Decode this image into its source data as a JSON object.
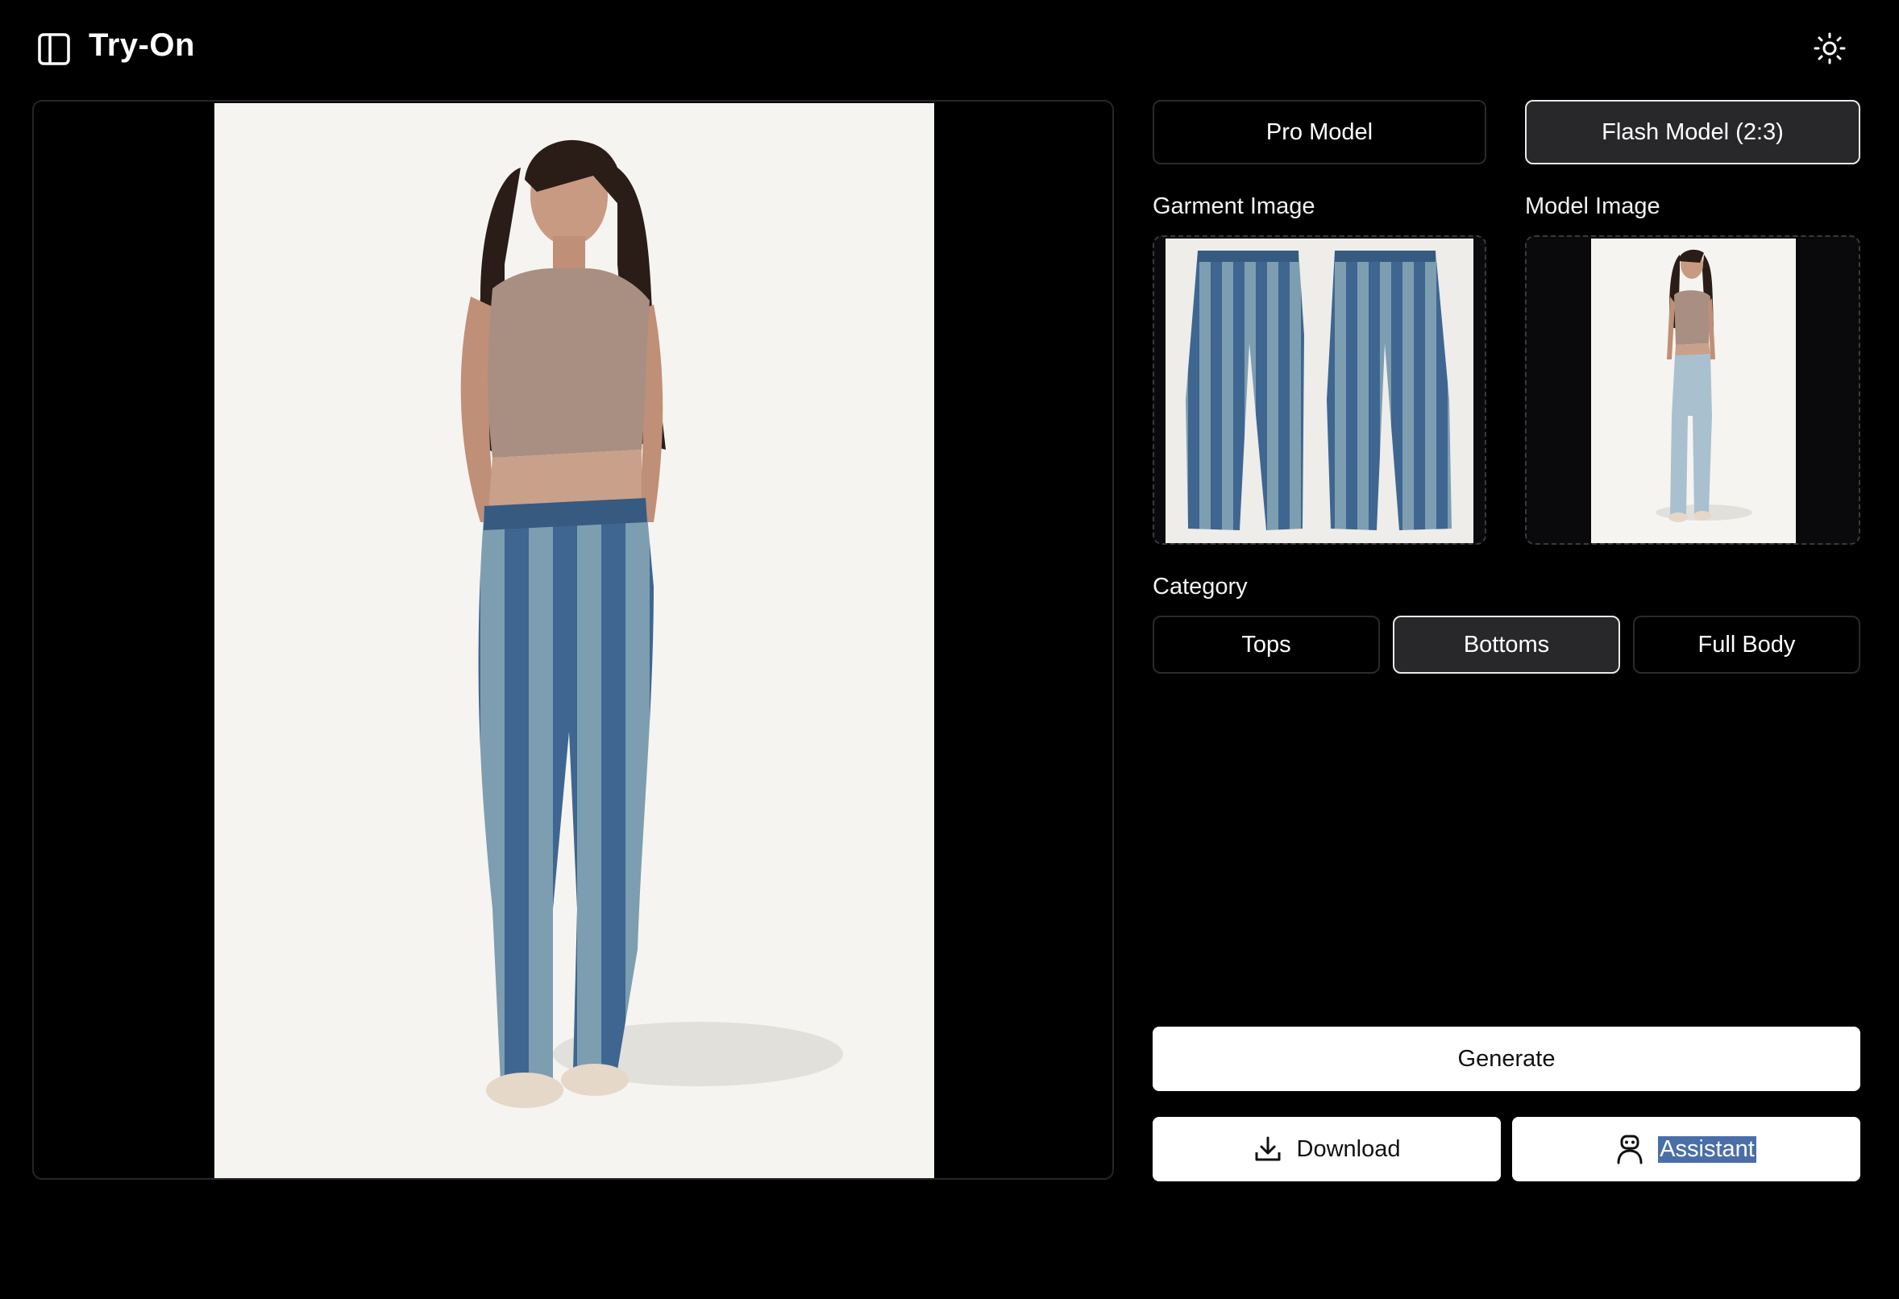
{
  "header": {
    "title": "Try-On"
  },
  "model_selector": {
    "options": [
      "Pro Model",
      "Flash Model (2:3)"
    ],
    "selected": "Flash Model (2:3)"
  },
  "uploads": {
    "garment_label": "Garment Image",
    "model_label": "Model Image"
  },
  "category": {
    "label": "Category",
    "options": [
      "Tops",
      "Bottoms",
      "Full Body"
    ],
    "selected": "Bottoms"
  },
  "actions": {
    "generate_label": "Generate",
    "download_label": "Download",
    "assistant_label": "Assistant"
  },
  "colors": {
    "background": "#000000",
    "active_button": "#28282b",
    "jeans_dark": "#3f6691",
    "jeans_light": "#7d9eb0",
    "top": "#a88f82",
    "photo_bg": "#f5f4f0"
  },
  "icons": {
    "sidebar": "sidebar-toggle-icon",
    "theme": "sun-icon",
    "download": "download-icon",
    "assistant": "robot-icon"
  }
}
